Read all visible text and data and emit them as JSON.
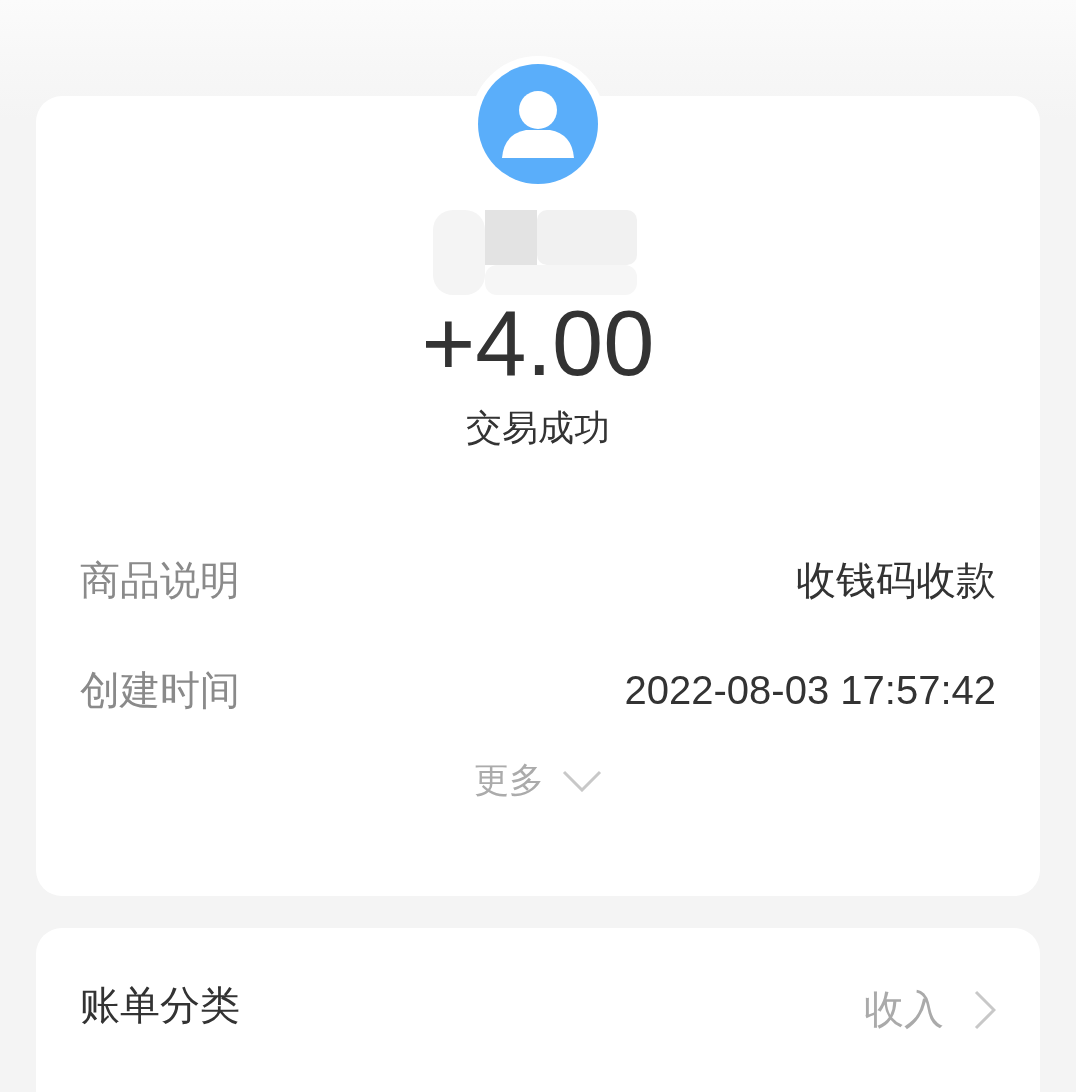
{
  "amount": "+4.00",
  "status": "交易成功",
  "details": [
    {
      "label": "商品说明",
      "value": "收钱码收款"
    },
    {
      "label": "创建时间",
      "value": "2022-08-03 17:57:42"
    }
  ],
  "more": "更多",
  "category": {
    "label": "账单分类",
    "value": "收入"
  }
}
